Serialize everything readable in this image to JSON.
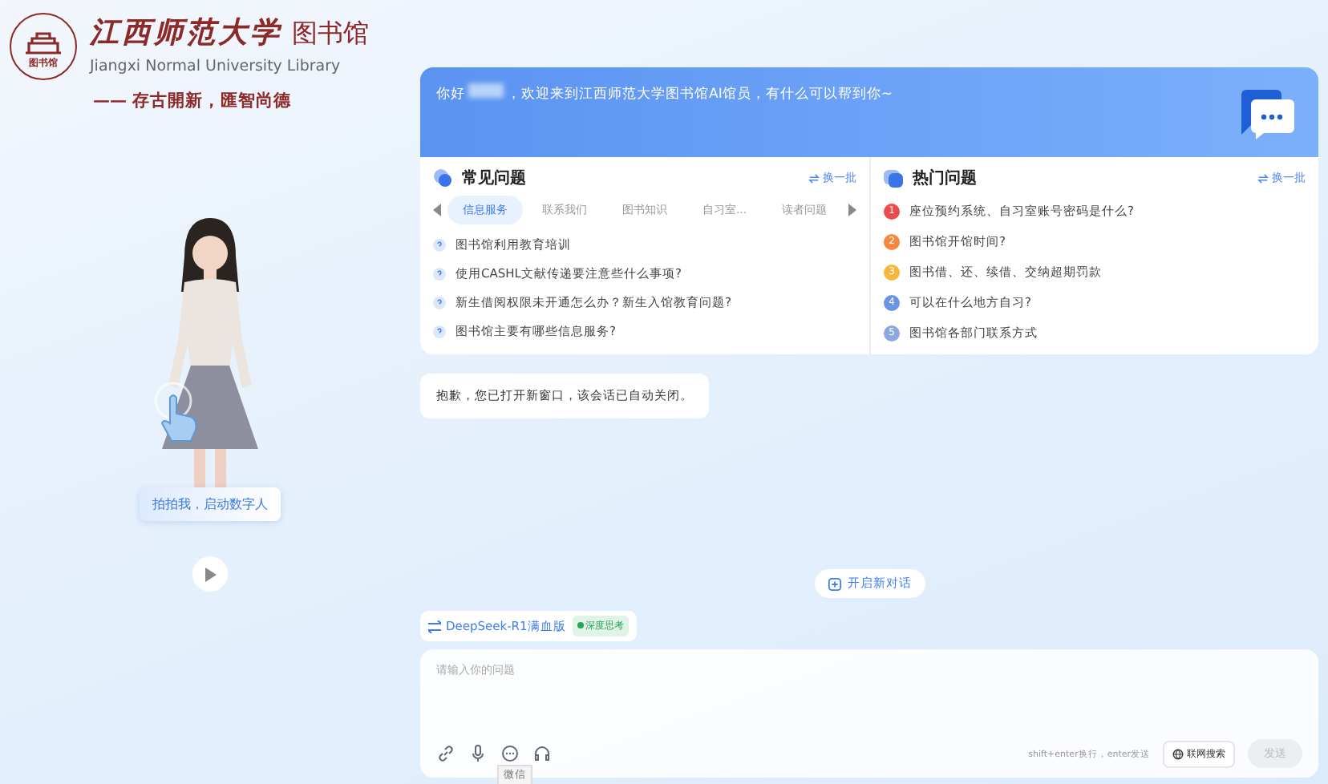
{
  "logo": {
    "name_cn": "江西师范大学",
    "suffix": "图书馆",
    "name_en": "Jiangxi Normal University Library",
    "motto": "—— 存古開新，匯智尚德",
    "seal_text": "图书馆"
  },
  "avatar": {
    "caption": "拍拍我，启动数字人"
  },
  "welcome": {
    "greeting": "你好",
    "message": "，欢迎来到江西师范大学图书馆AI馆员，有什么可以帮到你~"
  },
  "faq": {
    "title": "常见问题",
    "refresh": "换一批",
    "tabs": [
      {
        "label": "信息服务",
        "selected": true
      },
      {
        "label": "联系我们",
        "selected": false
      },
      {
        "label": "图书知识",
        "selected": false
      },
      {
        "label": "自习室...",
        "selected": false
      },
      {
        "label": "读者问题",
        "selected": false
      }
    ],
    "items": [
      "图书馆利用教育培训",
      "使用CASHL文献传递要注意些什么事项?",
      "新生借阅权限未开通怎么办？新生入馆教育问题?",
      "图书馆主要有哪些信息服务?"
    ]
  },
  "hot": {
    "title": "热门问题",
    "refresh": "换一批",
    "items": [
      {
        "rank": "1",
        "color": "#ef4a4a",
        "text": "座位预约系统、自习室账号密码是什么?"
      },
      {
        "rank": "2",
        "color": "#f7873c",
        "text": "图书馆开馆时间?"
      },
      {
        "rank": "3",
        "color": "#f6b73c",
        "text": "图书借、还、续借、交纳超期罚款"
      },
      {
        "rank": "4",
        "color": "#6d93e6",
        "text": "可以在什么地方自习?"
      },
      {
        "rank": "5",
        "color": "#8ca6de",
        "text": "图书馆各部门联系方式"
      }
    ]
  },
  "messages": [
    {
      "text": "抱歉，您已打开新窗口，该会话已自动关闭。"
    }
  ],
  "new_chat": "开启新对话",
  "model": {
    "name": "DeepSeek-R1满血版",
    "tag": "深度思考"
  },
  "input": {
    "placeholder": "请输入你的问题",
    "hint": "shift+enter换行，enter发送",
    "web_search": "联网搜索",
    "send": "发送",
    "send_disabled": true,
    "tooltip": "微信"
  }
}
